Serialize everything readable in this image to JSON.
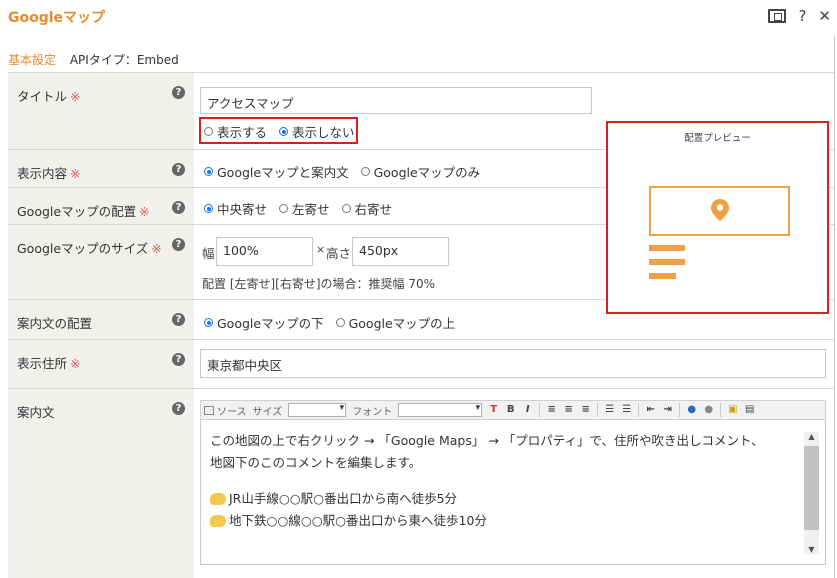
{
  "dialog": {
    "title": "Googleマップ",
    "help_glyph": "?",
    "close_glyph": "✕"
  },
  "tabs": {
    "active": "基本設定",
    "api_type": "APIタイプ：Embed"
  },
  "required_mark": "※",
  "help_mark": "?",
  "rows": {
    "title": {
      "label": "タイトル",
      "value": "アクセスマップ",
      "options": [
        "表示する",
        "表示しない"
      ],
      "selected": 1
    },
    "display": {
      "label": "表示内容",
      "options": [
        "Googleマップと案内文",
        "Googleマップのみ"
      ],
      "selected": 0
    },
    "position": {
      "label": "Googleマップの配置",
      "options": [
        "中央寄せ",
        "左寄せ",
        "右寄せ"
      ],
      "selected": 0
    },
    "size": {
      "label": "Googleマップのサイズ",
      "width_label": "幅",
      "width_value": "100%",
      "times": "×",
      "height_label": "高さ",
      "height_value": "450px",
      "hint": "配置 [左寄せ][右寄せ]の場合：推奨幅 70%"
    },
    "text_position": {
      "label": "案内文の配置",
      "options": [
        "Googleマップの下",
        "Googleマップの上"
      ],
      "selected": 0
    },
    "address": {
      "label": "表示住所",
      "value": "東京都中央区"
    },
    "guide": {
      "label": "案内文",
      "toolbar": {
        "source": "ソース",
        "size": "サイズ",
        "font": "フォント"
      },
      "lines": [
        "この地図の上で右クリック → 「Google Maps」 → 「プロパティ」で、住所や吹き出しコメント、",
        "地図下のこのコメントを編集します。",
        "",
        "JR山手線○○駅○番出口から南へ徒歩5分",
        "地下鉄○○線○○駅○番出口から東へ徒歩10分"
      ]
    }
  },
  "preview": {
    "title": "配置プレビュー"
  },
  "colors": {
    "accent": "#e8892b",
    "highlight": "#d92020",
    "radio": "#1a73e8",
    "label_bg": "#f2f0ed"
  }
}
